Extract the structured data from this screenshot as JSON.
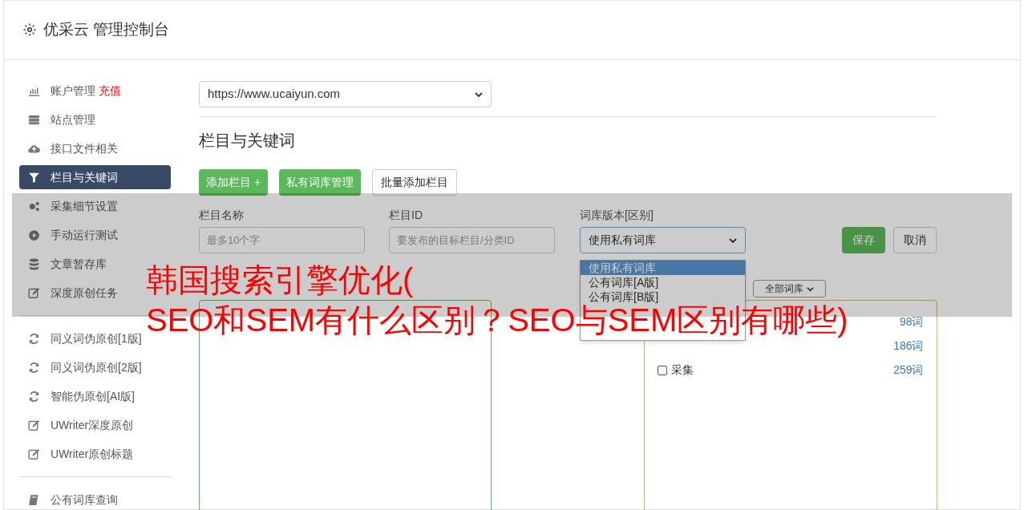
{
  "header": {
    "title": "优采云 管理控制台"
  },
  "sidebar": {
    "groups": [
      [
        {
          "label": "账户管理",
          "badge": "充值",
          "selected": false
        },
        {
          "label": "站点管理",
          "selected": false
        },
        {
          "label": "接口文件相关",
          "selected": false
        },
        {
          "label": "栏目与关键词",
          "selected": true
        },
        {
          "label": "采集细节设置",
          "selected": false
        },
        {
          "label": "手动运行测试",
          "selected": false
        },
        {
          "label": "文章暂存库",
          "selected": false
        },
        {
          "label": "深度原创任务",
          "selected": false
        }
      ],
      [
        {
          "label": "同义词伪原创[1版]",
          "selected": false
        },
        {
          "label": "同义词伪原创[2版]",
          "selected": false
        },
        {
          "label": "智能伪原创[AI版]",
          "selected": false
        },
        {
          "label": "UWriter深度原创",
          "selected": false
        },
        {
          "label": "UWriter原创标题",
          "selected": false
        }
      ],
      [
        {
          "label": "公有词库查询",
          "selected": false
        }
      ]
    ]
  },
  "site_select": {
    "value": "https://www.ucaiyun.com"
  },
  "section_title": "栏目与关键词",
  "actions": [
    {
      "label": "添加栏目 +",
      "kind": "primary"
    },
    {
      "label": "私有词库管理",
      "kind": "primary"
    },
    {
      "label": "批量添加栏目",
      "kind": "default"
    }
  ],
  "form": {
    "fields": [
      {
        "label": "栏目名称",
        "placeholder": "最多10个字"
      },
      {
        "label": "栏目ID",
        "placeholder": "要发布的目标栏目/分类ID"
      }
    ],
    "library": {
      "label": "词库版本[区别]",
      "value": "使用私有词库",
      "options": [
        {
          "label": "使用私有词库",
          "selected": true
        },
        {
          "label": "公有词库[A版]",
          "selected": false
        },
        {
          "label": "公有词库[B版]",
          "selected": false
        }
      ]
    },
    "save": "保存",
    "cancel": "取消"
  },
  "filter_select": {
    "value": "全部词库"
  },
  "libraries": [
    {
      "count": "98词"
    },
    {
      "count": "186词"
    },
    {
      "label": "采集",
      "checked": false,
      "count": "259词"
    }
  ],
  "headline_lines": [
    "韩国搜索引擎优化(",
    "SEO和SEM有什么区别？SEO与SEM区别有哪些)"
  ]
}
